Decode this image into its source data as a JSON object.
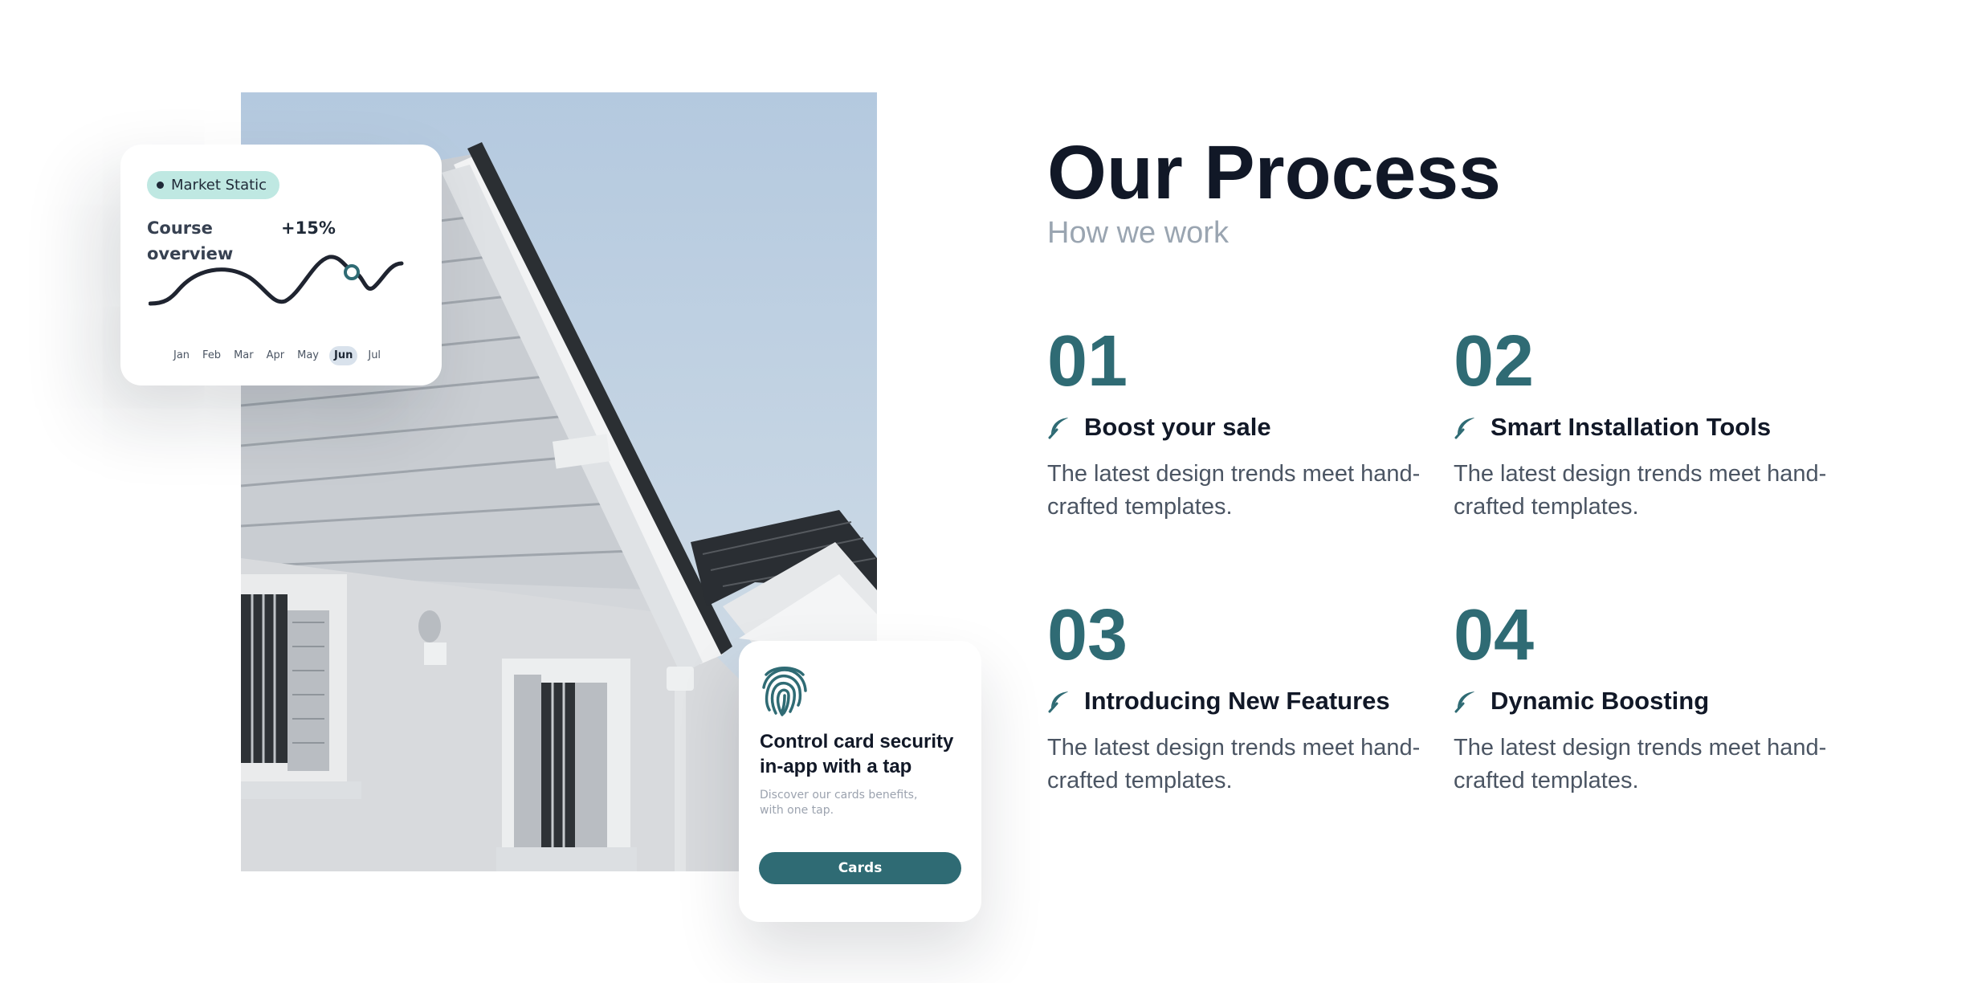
{
  "market_card": {
    "badge": "Market Static",
    "label": "Course overview",
    "change": "+15%",
    "months": [
      "Jan",
      "Feb",
      "Mar",
      "Apr",
      "May",
      "Jun",
      "Jul"
    ],
    "active_month": "Jun"
  },
  "security_card": {
    "title": "Control card security in-app with a tap",
    "description": "Discover our cards benefits, with one tap.",
    "button_label": "Cards"
  },
  "process": {
    "title": "Our Process",
    "subtitle": "How we work",
    "steps": [
      {
        "number": "01",
        "title": "Boost your sale",
        "description": "The latest design trends meet hand-crafted templates."
      },
      {
        "number": "02",
        "title": "Smart Installation Tools",
        "description": "The latest design trends meet hand-crafted templates."
      },
      {
        "number": "03",
        "title": "Introducing New Features",
        "description": "The latest design trends meet hand-crafted templates."
      },
      {
        "number": "04",
        "title": "Dynamic Boosting",
        "description": "The latest design trends meet hand-crafted templates."
      }
    ]
  },
  "icons": {
    "step_icon": "feather-icon",
    "security_icon": "fingerprint-icon"
  },
  "colors": {
    "accent": "#2f6b74",
    "badge_bg": "#bfe8e2",
    "heading": "#111827",
    "muted": "#9aa5b1"
  }
}
